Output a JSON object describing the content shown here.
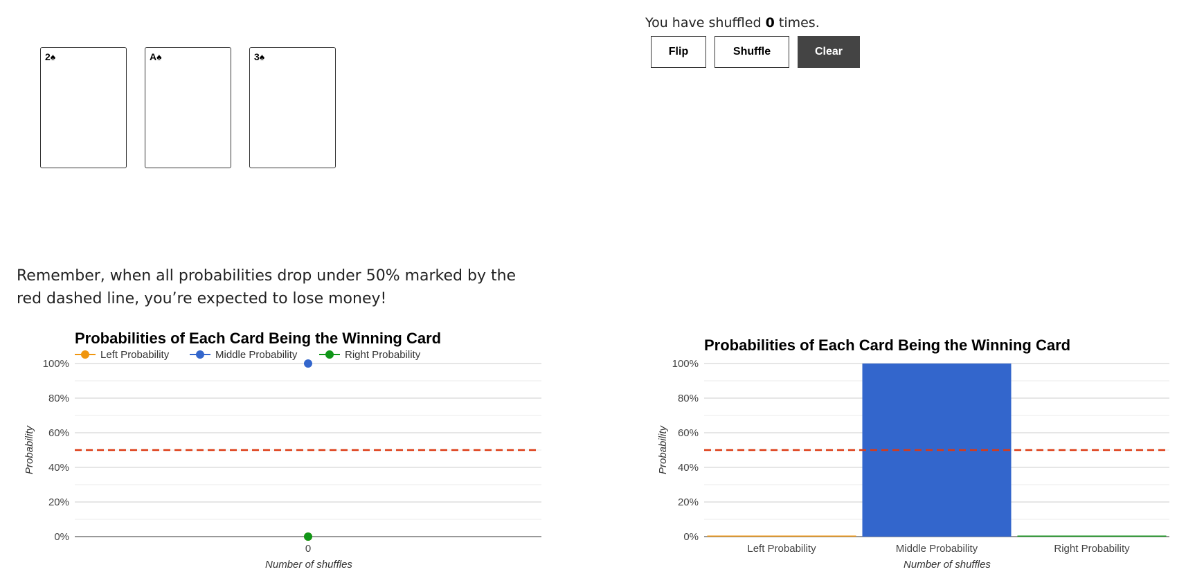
{
  "cards": [
    {
      "label": "2♠"
    },
    {
      "label": "A♠"
    },
    {
      "label": "3♠"
    }
  ],
  "status": {
    "prefix": "You have shuffled ",
    "count": "0",
    "suffix": " times."
  },
  "buttons": {
    "flip": "Flip",
    "shuffle": "Shuffle",
    "clear": "Clear"
  },
  "reminder": "Remember, when all probabilities drop under 50% marked by the red dashed line, you’re expected to lose money!",
  "colors": {
    "left": "#f0960f",
    "middle": "#3366cc",
    "right": "#109618",
    "threshold": "#dc3912",
    "grid": "#d9d9d9"
  },
  "chart_data": [
    {
      "type": "line",
      "title": "Probabilities of Each Card Being the Winning Card",
      "xlabel": "Number of shuffles",
      "ylabel": "Probability",
      "x": [
        0
      ],
      "x_tick_labels": [
        "0"
      ],
      "y_tick_labels": [
        "100%",
        "80%",
        "60%",
        "40%",
        "20%",
        "0%"
      ],
      "ylim": [
        0,
        100
      ],
      "threshold": 50,
      "legend": "top",
      "series": [
        {
          "name": "Left Probability",
          "values": [
            0
          ]
        },
        {
          "name": "Middle Probability",
          "values": [
            100
          ]
        },
        {
          "name": "Right Probability",
          "values": [
            0
          ]
        }
      ]
    },
    {
      "type": "bar",
      "title": "Probabilities of Each Card Being the Winning Card",
      "xlabel": "Number of shuffles",
      "ylabel": "Probability",
      "categories": [
        "Left Probability",
        "Middle Probability",
        "Right Probability"
      ],
      "values": [
        0,
        100,
        0
      ],
      "y_tick_labels": [
        "100%",
        "80%",
        "60%",
        "40%",
        "20%",
        "0%"
      ],
      "ylim": [
        0,
        100
      ],
      "threshold": 50
    }
  ]
}
